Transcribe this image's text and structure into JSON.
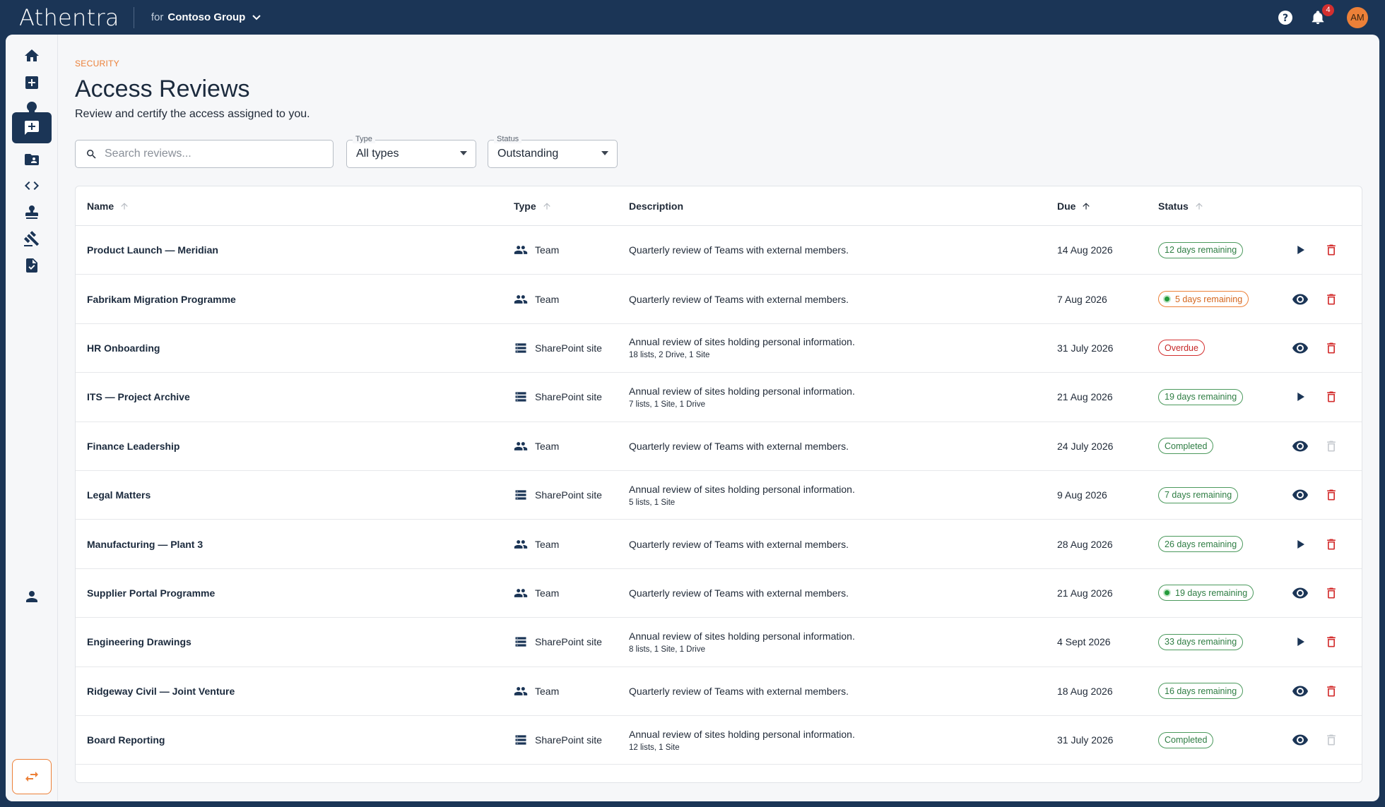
{
  "app": {
    "brand": "Athentra",
    "org_prefix": "for",
    "org_name": "Contoso Group"
  },
  "topbar": {
    "notification_count": "4",
    "avatar_initials": "AM"
  },
  "page": {
    "eyebrow": "SECURITY",
    "title": "Access Reviews",
    "subtitle": "Review and certify the access assigned to you."
  },
  "filters": {
    "search_placeholder": "Search reviews...",
    "type_label": "Type",
    "type_value": "All types",
    "status_label": "Status",
    "status_value": "Outstanding"
  },
  "table": {
    "headers": {
      "name": "Name",
      "type": "Type",
      "description": "Description",
      "due": "Due",
      "status": "Status"
    },
    "rows": [
      {
        "name": "Product Launch — Meridian",
        "type": "Team",
        "type_icon": "team-icon",
        "description": "Quarterly review of Teams with external members.",
        "sub": "",
        "due": "14 Aug 2026",
        "status": "12 days remaining",
        "status_color": "green",
        "action": "play",
        "delete_enabled": true
      },
      {
        "name": "Fabrikam Migration Programme",
        "type": "Team",
        "type_icon": "team-icon",
        "description": "Quarterly review of Teams with external members.",
        "sub": "",
        "due": "7 Aug 2026",
        "status": "5 days remaining",
        "status_color": "orange-dot",
        "action": "view",
        "delete_enabled": true
      },
      {
        "name": "HR Onboarding",
        "type": "SharePoint site",
        "type_icon": "sharepoint-icon",
        "description": "Annual review of sites holding personal information.",
        "sub": "18 lists, 2 Drive, 1 Site",
        "due": "31 July 2026",
        "status": "Overdue",
        "status_color": "red",
        "action": "view",
        "delete_enabled": true
      },
      {
        "name": "ITS — Project Archive",
        "type": "SharePoint site",
        "type_icon": "sharepoint-icon",
        "description": "Annual review of sites holding personal information.",
        "sub": "7 lists, 1 Site, 1 Drive",
        "due": "21 Aug 2026",
        "status": "19 days remaining",
        "status_color": "green",
        "action": "play",
        "delete_enabled": true
      },
      {
        "name": "Finance Leadership",
        "type": "Team",
        "type_icon": "team-icon",
        "description": "Quarterly review of Teams with external members.",
        "sub": "",
        "due": "24 July 2026",
        "status": "Completed",
        "status_color": "green",
        "action": "view",
        "delete_enabled": false
      },
      {
        "name": "Legal Matters",
        "type": "SharePoint site",
        "type_icon": "sharepoint-icon",
        "description": "Annual review of sites holding personal information.",
        "sub": "5 lists, 1 Site",
        "due": "9 Aug 2026",
        "status": "7 days remaining",
        "status_color": "green",
        "action": "view",
        "delete_enabled": true
      },
      {
        "name": "Manufacturing — Plant 3",
        "type": "Team",
        "type_icon": "team-icon",
        "description": "Quarterly review of Teams with external members.",
        "sub": "",
        "due": "28 Aug 2026",
        "status": "26 days remaining",
        "status_color": "green",
        "action": "play",
        "delete_enabled": true
      },
      {
        "name": "Supplier Portal Programme",
        "type": "Team",
        "type_icon": "team-icon",
        "description": "Quarterly review of Teams with external members.",
        "sub": "",
        "due": "21 Aug 2026",
        "status": "19 days remaining",
        "status_color": "green-dot",
        "action": "view",
        "delete_enabled": true
      },
      {
        "name": "Engineering Drawings",
        "type": "SharePoint site",
        "type_icon": "sharepoint-icon",
        "description": "Annual review of sites holding personal information.",
        "sub": "8 lists, 1 Site, 1 Drive",
        "due": "4 Sept 2026",
        "status": "33 days remaining",
        "status_color": "green",
        "action": "play",
        "delete_enabled": true
      },
      {
        "name": "Ridgeway Civil — Joint Venture",
        "type": "Team",
        "type_icon": "team-icon",
        "description": "Quarterly review of Teams with external members.",
        "sub": "",
        "due": "18 Aug 2026",
        "status": "16 days remaining",
        "status_color": "green",
        "action": "view",
        "delete_enabled": true
      },
      {
        "name": "Board Reporting",
        "type": "SharePoint site",
        "type_icon": "sharepoint-icon",
        "description": "Annual review of sites holding personal information.",
        "sub": "12 lists, 1 Site",
        "due": "31 July 2026",
        "status": "Completed",
        "status_color": "green",
        "action": "view",
        "delete_enabled": false
      }
    ]
  },
  "colors": {
    "navy": "#1b3556",
    "accent": "#ec8038",
    "danger": "#d32f2f",
    "success": "#2e7d43"
  }
}
